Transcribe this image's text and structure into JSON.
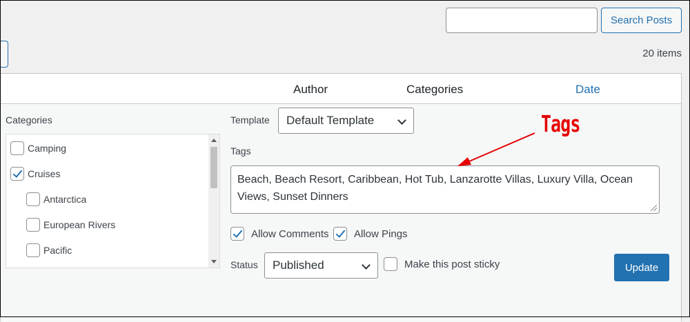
{
  "toolbar": {
    "search_value": "",
    "search_button": "Search Posts",
    "items_count": "20 items"
  },
  "table": {
    "columns": [
      "Author",
      "Categories",
      "Date"
    ]
  },
  "quick_edit": {
    "categories_label": "Categories",
    "categories": [
      {
        "label": "Camping",
        "checked": false,
        "child": false
      },
      {
        "label": "Cruises",
        "checked": true,
        "child": false
      },
      {
        "label": "Antarctica",
        "checked": false,
        "child": true
      },
      {
        "label": "European Rivers",
        "checked": false,
        "child": true
      },
      {
        "label": "Pacific",
        "checked": false,
        "child": true
      }
    ],
    "template_label": "Template",
    "template_value": "Default Template",
    "tags_label": "Tags",
    "tags_value": "Beach, Beach Resort, Caribbean, Hot Tub, Lanzarotte Villas, Luxury Villa, Ocean Views, Sunset Dinners",
    "allow_comments_label": "Allow Comments",
    "allow_comments_checked": true,
    "allow_pings_label": "Allow Pings",
    "allow_pings_checked": true,
    "status_label": "Status",
    "status_value": "Published",
    "sticky_label": "Make this post sticky",
    "sticky_checked": false,
    "update_button": "Update"
  },
  "annotation": {
    "label": "Tags",
    "color": "#e60000"
  },
  "colors": {
    "accent": "#2271b1",
    "background": "#f0f0f1"
  }
}
